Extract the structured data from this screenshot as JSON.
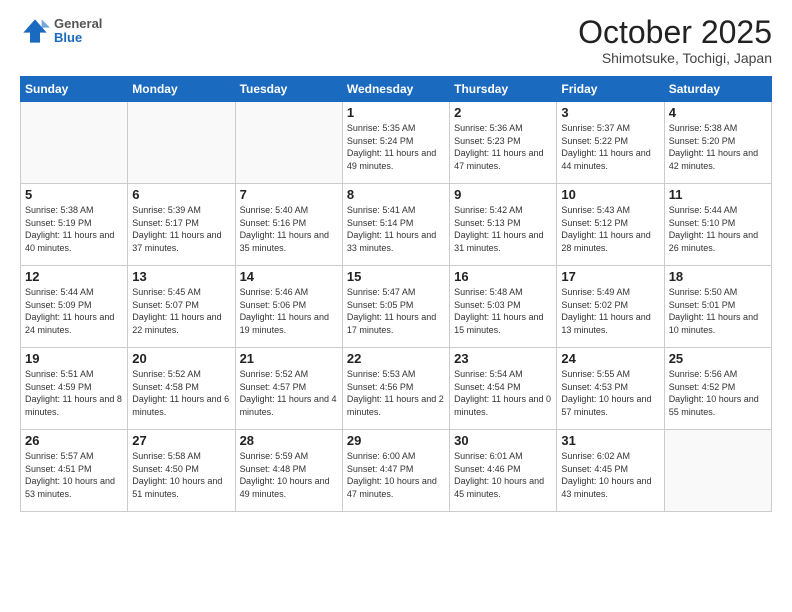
{
  "header": {
    "logo": {
      "general": "General",
      "blue": "Blue"
    },
    "month": "October 2025",
    "location": "Shimotsuke, Tochigi, Japan"
  },
  "weekdays": [
    "Sunday",
    "Monday",
    "Tuesday",
    "Wednesday",
    "Thursday",
    "Friday",
    "Saturday"
  ],
  "weeks": [
    [
      {
        "day": "",
        "info": ""
      },
      {
        "day": "",
        "info": ""
      },
      {
        "day": "",
        "info": ""
      },
      {
        "day": "1",
        "info": "Sunrise: 5:35 AM\nSunset: 5:24 PM\nDaylight: 11 hours\nand 49 minutes."
      },
      {
        "day": "2",
        "info": "Sunrise: 5:36 AM\nSunset: 5:23 PM\nDaylight: 11 hours\nand 47 minutes."
      },
      {
        "day": "3",
        "info": "Sunrise: 5:37 AM\nSunset: 5:22 PM\nDaylight: 11 hours\nand 44 minutes."
      },
      {
        "day": "4",
        "info": "Sunrise: 5:38 AM\nSunset: 5:20 PM\nDaylight: 11 hours\nand 42 minutes."
      }
    ],
    [
      {
        "day": "5",
        "info": "Sunrise: 5:38 AM\nSunset: 5:19 PM\nDaylight: 11 hours\nand 40 minutes."
      },
      {
        "day": "6",
        "info": "Sunrise: 5:39 AM\nSunset: 5:17 PM\nDaylight: 11 hours\nand 37 minutes."
      },
      {
        "day": "7",
        "info": "Sunrise: 5:40 AM\nSunset: 5:16 PM\nDaylight: 11 hours\nand 35 minutes."
      },
      {
        "day": "8",
        "info": "Sunrise: 5:41 AM\nSunset: 5:14 PM\nDaylight: 11 hours\nand 33 minutes."
      },
      {
        "day": "9",
        "info": "Sunrise: 5:42 AM\nSunset: 5:13 PM\nDaylight: 11 hours\nand 31 minutes."
      },
      {
        "day": "10",
        "info": "Sunrise: 5:43 AM\nSunset: 5:12 PM\nDaylight: 11 hours\nand 28 minutes."
      },
      {
        "day": "11",
        "info": "Sunrise: 5:44 AM\nSunset: 5:10 PM\nDaylight: 11 hours\nand 26 minutes."
      }
    ],
    [
      {
        "day": "12",
        "info": "Sunrise: 5:44 AM\nSunset: 5:09 PM\nDaylight: 11 hours\nand 24 minutes."
      },
      {
        "day": "13",
        "info": "Sunrise: 5:45 AM\nSunset: 5:07 PM\nDaylight: 11 hours\nand 22 minutes."
      },
      {
        "day": "14",
        "info": "Sunrise: 5:46 AM\nSunset: 5:06 PM\nDaylight: 11 hours\nand 19 minutes."
      },
      {
        "day": "15",
        "info": "Sunrise: 5:47 AM\nSunset: 5:05 PM\nDaylight: 11 hours\nand 17 minutes."
      },
      {
        "day": "16",
        "info": "Sunrise: 5:48 AM\nSunset: 5:03 PM\nDaylight: 11 hours\nand 15 minutes."
      },
      {
        "day": "17",
        "info": "Sunrise: 5:49 AM\nSunset: 5:02 PM\nDaylight: 11 hours\nand 13 minutes."
      },
      {
        "day": "18",
        "info": "Sunrise: 5:50 AM\nSunset: 5:01 PM\nDaylight: 11 hours\nand 10 minutes."
      }
    ],
    [
      {
        "day": "19",
        "info": "Sunrise: 5:51 AM\nSunset: 4:59 PM\nDaylight: 11 hours\nand 8 minutes."
      },
      {
        "day": "20",
        "info": "Sunrise: 5:52 AM\nSunset: 4:58 PM\nDaylight: 11 hours\nand 6 minutes."
      },
      {
        "day": "21",
        "info": "Sunrise: 5:52 AM\nSunset: 4:57 PM\nDaylight: 11 hours\nand 4 minutes."
      },
      {
        "day": "22",
        "info": "Sunrise: 5:53 AM\nSunset: 4:56 PM\nDaylight: 11 hours\nand 2 minutes."
      },
      {
        "day": "23",
        "info": "Sunrise: 5:54 AM\nSunset: 4:54 PM\nDaylight: 11 hours\nand 0 minutes."
      },
      {
        "day": "24",
        "info": "Sunrise: 5:55 AM\nSunset: 4:53 PM\nDaylight: 10 hours\nand 57 minutes."
      },
      {
        "day": "25",
        "info": "Sunrise: 5:56 AM\nSunset: 4:52 PM\nDaylight: 10 hours\nand 55 minutes."
      }
    ],
    [
      {
        "day": "26",
        "info": "Sunrise: 5:57 AM\nSunset: 4:51 PM\nDaylight: 10 hours\nand 53 minutes."
      },
      {
        "day": "27",
        "info": "Sunrise: 5:58 AM\nSunset: 4:50 PM\nDaylight: 10 hours\nand 51 minutes."
      },
      {
        "day": "28",
        "info": "Sunrise: 5:59 AM\nSunset: 4:48 PM\nDaylight: 10 hours\nand 49 minutes."
      },
      {
        "day": "29",
        "info": "Sunrise: 6:00 AM\nSunset: 4:47 PM\nDaylight: 10 hours\nand 47 minutes."
      },
      {
        "day": "30",
        "info": "Sunrise: 6:01 AM\nSunset: 4:46 PM\nDaylight: 10 hours\nand 45 minutes."
      },
      {
        "day": "31",
        "info": "Sunrise: 6:02 AM\nSunset: 4:45 PM\nDaylight: 10 hours\nand 43 minutes."
      },
      {
        "day": "",
        "info": ""
      }
    ]
  ]
}
